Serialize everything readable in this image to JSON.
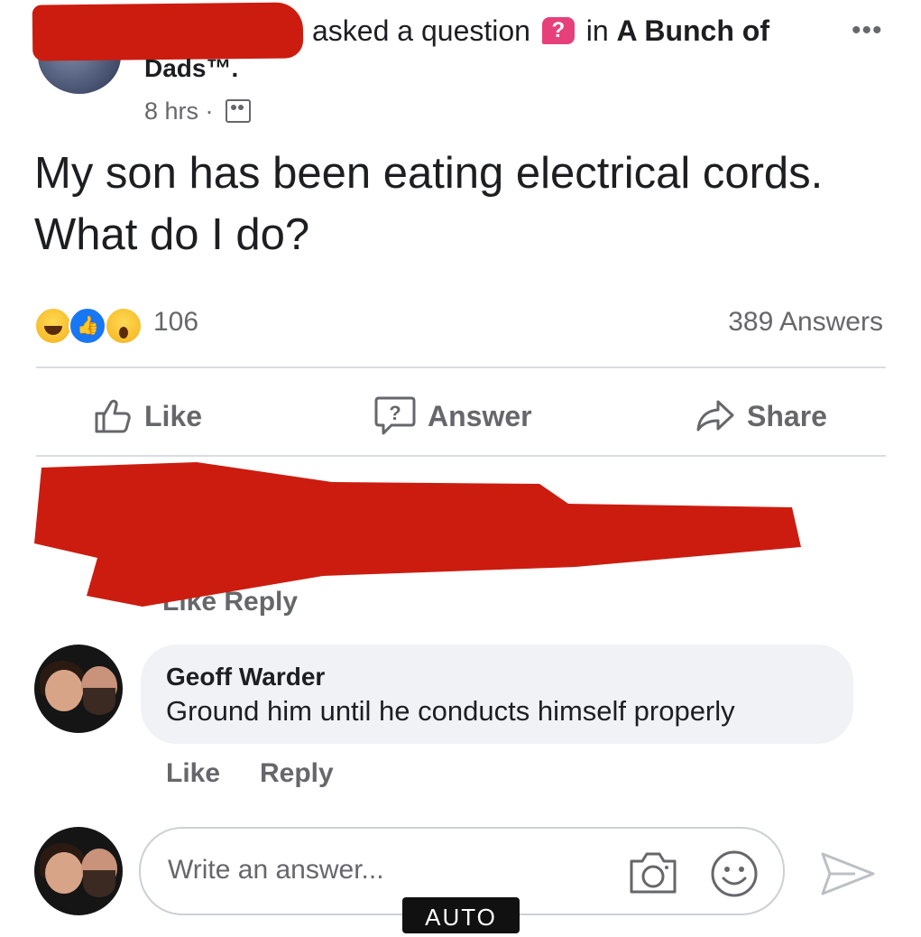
{
  "post": {
    "author_redacted": true,
    "action_text": "asked a question",
    "question_badge": "?",
    "in_text": "in",
    "group_name_start": "A Bunch of",
    "group_name_end": "Dads™.",
    "time": "8 hrs ·",
    "question": "My son has been eating electrical cords. What do I do?"
  },
  "stats": {
    "reaction_count": "106",
    "answers": "389 Answers",
    "reaction_icons": [
      "haha-icon",
      "like-icon",
      "wow-icon"
    ]
  },
  "actions": {
    "like": "Like",
    "answer": "Answer",
    "share": "Share"
  },
  "redacted_comment": {
    "peek_text": "Like   Reply"
  },
  "comment": {
    "author": "Geoff Warder",
    "text": "Ground him until he conducts himself properly",
    "like": "Like",
    "reply": "Reply"
  },
  "answer_box": {
    "placeholder": "Write an answer...",
    "auto_label": "AUTO"
  },
  "colors": {
    "redaction": "#cc1c10",
    "meta_gray": "#65676b",
    "bubble": "#f0f2f5",
    "question_badge": "#e6407a"
  }
}
